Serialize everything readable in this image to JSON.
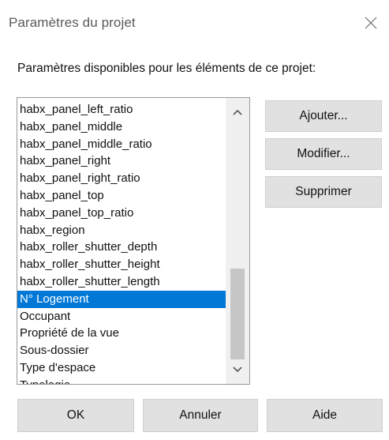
{
  "window": {
    "title": "Paramètres du projet",
    "close_icon": "close-icon"
  },
  "prompt": "Paramètres disponibles pour les éléments de ce projet:",
  "list": {
    "items": [
      "habx_panel_left_ratio",
      "habx_panel_middle",
      "habx_panel_middle_ratio",
      "habx_panel_right",
      "habx_panel_right_ratio",
      "habx_panel_top",
      "habx_panel_top_ratio",
      "habx_region",
      "habx_roller_shutter_depth",
      "habx_roller_shutter_height",
      "habx_roller_shutter_length",
      "N° Logement",
      "Occupant",
      "Propriété de la vue",
      "Sous-dossier",
      "Type d'espace",
      "Typologie"
    ],
    "selected": "N° Logement",
    "selection_color": "#0078d7"
  },
  "side_buttons": {
    "add": "Ajouter...",
    "modify": "Modifier...",
    "delete": "Supprimer"
  },
  "bottom_buttons": {
    "ok": "OK",
    "cancel": "Annuler",
    "help": "Aide"
  }
}
